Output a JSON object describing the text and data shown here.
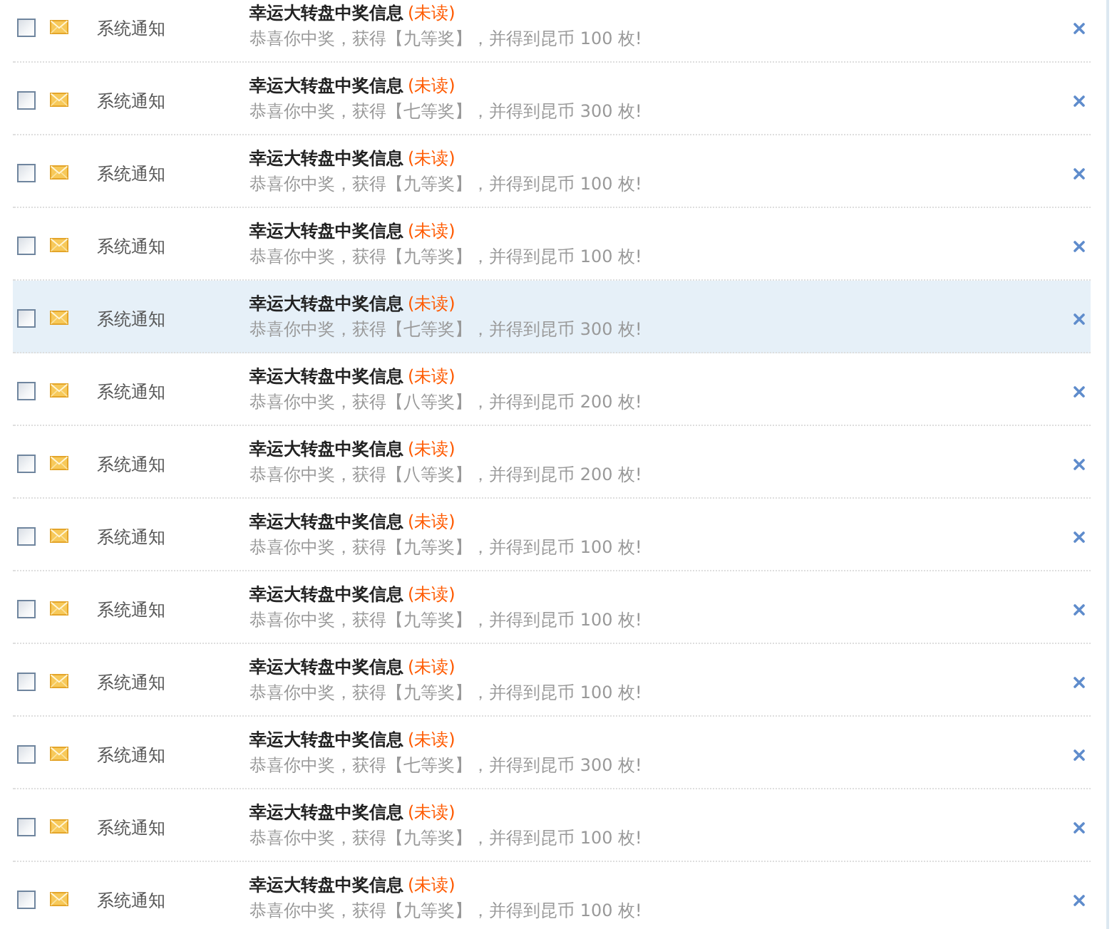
{
  "messages": [
    {
      "checked": false,
      "highlighted": false,
      "sender": "系统通知",
      "title": "幸运大转盘中奖信息",
      "status": "(未读)",
      "body": "恭喜你中奖，获得【九等奖】，并得到昆币 100 枚!"
    },
    {
      "checked": false,
      "highlighted": false,
      "sender": "系统通知",
      "title": "幸运大转盘中奖信息",
      "status": "(未读)",
      "body": "恭喜你中奖，获得【七等奖】，并得到昆币 300 枚!"
    },
    {
      "checked": false,
      "highlighted": false,
      "sender": "系统通知",
      "title": "幸运大转盘中奖信息",
      "status": "(未读)",
      "body": "恭喜你中奖，获得【九等奖】，并得到昆币 100 枚!"
    },
    {
      "checked": false,
      "highlighted": false,
      "sender": "系统通知",
      "title": "幸运大转盘中奖信息",
      "status": "(未读)",
      "body": "恭喜你中奖，获得【九等奖】，并得到昆币 100 枚!"
    },
    {
      "checked": false,
      "highlighted": true,
      "sender": "系统通知",
      "title": "幸运大转盘中奖信息",
      "status": "(未读)",
      "body": "恭喜你中奖，获得【七等奖】，并得到昆币 300 枚!"
    },
    {
      "checked": false,
      "highlighted": false,
      "sender": "系统通知",
      "title": "幸运大转盘中奖信息",
      "status": "(未读)",
      "body": "恭喜你中奖，获得【八等奖】，并得到昆币 200 枚!"
    },
    {
      "checked": false,
      "highlighted": false,
      "sender": "系统通知",
      "title": "幸运大转盘中奖信息",
      "status": "(未读)",
      "body": "恭喜你中奖，获得【八等奖】，并得到昆币 200 枚!"
    },
    {
      "checked": false,
      "highlighted": false,
      "sender": "系统通知",
      "title": "幸运大转盘中奖信息",
      "status": "(未读)",
      "body": "恭喜你中奖，获得【九等奖】，并得到昆币 100 枚!"
    },
    {
      "checked": false,
      "highlighted": false,
      "sender": "系统通知",
      "title": "幸运大转盘中奖信息",
      "status": "(未读)",
      "body": "恭喜你中奖，获得【九等奖】，并得到昆币 100 枚!"
    },
    {
      "checked": false,
      "highlighted": false,
      "sender": "系统通知",
      "title": "幸运大转盘中奖信息",
      "status": "(未读)",
      "body": "恭喜你中奖，获得【九等奖】，并得到昆币 100 枚!"
    },
    {
      "checked": false,
      "highlighted": false,
      "sender": "系统通知",
      "title": "幸运大转盘中奖信息",
      "status": "(未读)",
      "body": "恭喜你中奖，获得【七等奖】，并得到昆币 300 枚!"
    },
    {
      "checked": false,
      "highlighted": false,
      "sender": "系统通知",
      "title": "幸运大转盘中奖信息",
      "status": "(未读)",
      "body": "恭喜你中奖，获得【九等奖】，并得到昆币 100 枚!"
    },
    {
      "checked": false,
      "highlighted": false,
      "sender": "系统通知",
      "title": "幸运大转盘中奖信息",
      "status": "(未读)",
      "body": "恭喜你中奖，获得【九等奖】，并得到昆币 100 枚!"
    }
  ]
}
